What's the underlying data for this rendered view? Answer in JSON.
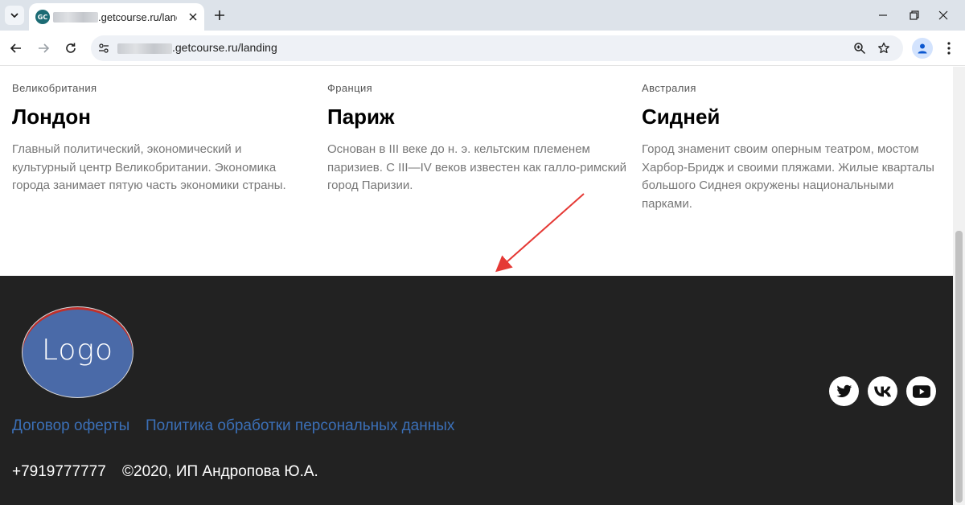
{
  "browser": {
    "tab": {
      "favicon_text": "GC",
      "title": ".getcourse.ru/landin"
    },
    "url": ".getcourse.ru/landing"
  },
  "cities": [
    {
      "country": "Великобритания",
      "name": "Лондон",
      "description": "Главный политический, экономический и культурный центр Великобритании. Экономика города занимает пятую часть экономики страны."
    },
    {
      "country": "Франция",
      "name": "Париж",
      "description": "Основан в III веке до н. э. кельтским племенем паризиев. С III—IV веков известен как галло-римский город Паризии."
    },
    {
      "country": "Австралия",
      "name": "Сидней",
      "description": "Город знаменит своим оперным театром, мостом Харбор-Бридж и своими пляжами. Жилые кварталы большого Сиднея окружены национальными парками."
    }
  ],
  "footer": {
    "logo_text": "Logo",
    "links": [
      "Договор оферты",
      "Политика обработки персональных данных"
    ],
    "phone": "+7919777777",
    "copyright": "©2020, ИП Андропова Ю.А.",
    "social": [
      "twitter-icon",
      "vk-icon",
      "youtube-icon"
    ]
  },
  "colors": {
    "footer_bg": "#222222",
    "link": "#3b6fb6",
    "logo_bg": "#4a6aa8",
    "annotation_arrow": "#e53935"
  }
}
